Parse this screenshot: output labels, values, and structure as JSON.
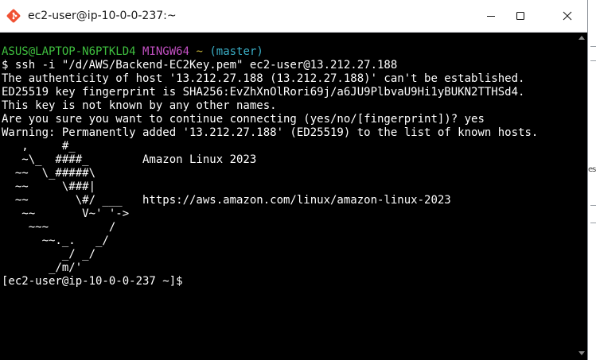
{
  "window": {
    "title": "ec2-user@ip-10-0-0-237:~",
    "icon": "git-bash-icon",
    "controls": [
      "minimize-icon",
      "maximize-icon",
      "close-icon"
    ]
  },
  "terminal": {
    "prompt": {
      "user_host": "ASUS@LAPTOP-N6PTKLD4",
      "system": "MINGW64",
      "path": "~",
      "branch": "(master)"
    },
    "command": "$ ssh -i \"/d/AWS/Backend-EC2Key.pem\" ec2-user@13.212.27.188",
    "output": [
      "The authenticity of host '13.212.27.188 (13.212.27.188)' can't be established.",
      "ED25519 key fingerprint is SHA256:EvZhXnOlRori69j/a6JU9PlbvaU9Hi1yBUKN2TTHSd4.",
      "This key is not known by any other names.",
      "Are you sure you want to continue connecting (yes/no/[fingerprint])? yes",
      "Warning: Permanently added '13.212.27.188' (ED25519) to the list of known hosts."
    ],
    "banner": [
      "   ,     #_",
      "   ~\\_  ####_        Amazon Linux 2023",
      "  ~~  \\_#####\\",
      "  ~~     \\###|",
      "  ~~       \\#/ ___   https://aws.amazon.com/linux/amazon-linux-2023",
      "   ~~       V~' '->",
      "    ~~~         /",
      "      ~~._.   _/",
      "         _/ _/",
      "       _/m/'"
    ],
    "remote_prompt": "[ec2-user@ip-10-0-0-237 ~]$ "
  },
  "background_window": {
    "partial_text": "es"
  },
  "colors": {
    "terminal_bg": "#000000",
    "terminal_fg": "#ffffff",
    "prompt_user": "#3fbf3f",
    "prompt_system": "#c350c3",
    "prompt_path": "#c8b53a",
    "prompt_branch": "#3bb0c8",
    "titlebar_bg": "#ffffff"
  }
}
